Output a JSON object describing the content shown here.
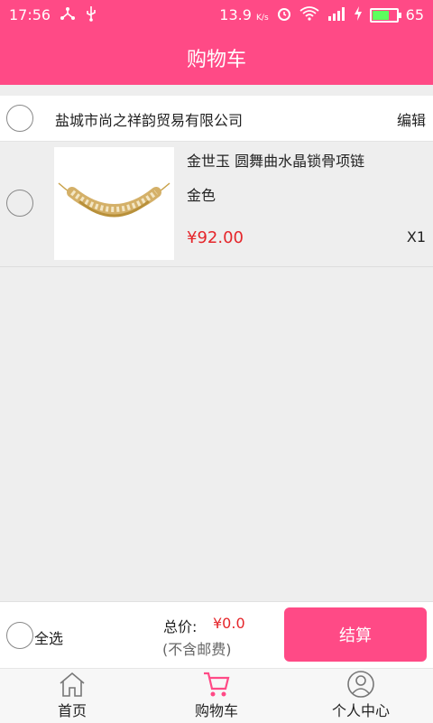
{
  "status_bar": {
    "time": "17:56",
    "speed": "13.9",
    "speed_unit": "K/s",
    "battery": "65",
    "battery_level": 0.65
  },
  "header": {
    "title": "购物车"
  },
  "shop": {
    "name": "盐城市尚之祥韵贸易有限公司",
    "edit_label": "编辑"
  },
  "cart_items": [
    {
      "title": "金世玉 圆舞曲水晶锁骨项链",
      "variant": "金色",
      "price": "¥92.00",
      "quantity": "X1",
      "image_icon": "necklace-image"
    }
  ],
  "footer": {
    "select_all_label": "全选",
    "total_label": "总价:",
    "total_value": "¥0.0",
    "shipping_note": "(不含邮费)",
    "checkout_label": "结算"
  },
  "tabs": [
    {
      "label": "首页",
      "icon": "home-icon"
    },
    {
      "label": "购物车",
      "icon": "cart-icon"
    },
    {
      "label": "个人中心",
      "icon": "user-icon"
    }
  ],
  "colors": {
    "brand": "#ff4a86",
    "price": "#e5262b",
    "background": "#eeeeee"
  }
}
